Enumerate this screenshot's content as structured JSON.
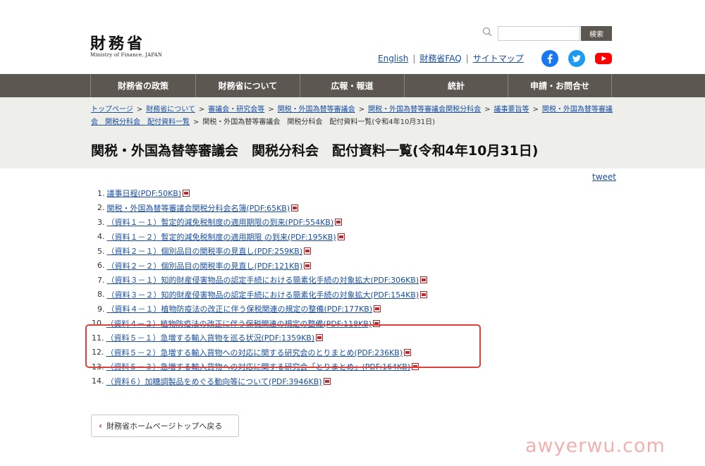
{
  "header": {
    "logo_main": "財務省",
    "logo_sub": "Ministry of Finance, JAPAN",
    "search_button": "検索",
    "links": [
      "English",
      "財務省FAQ",
      "サイトマップ"
    ],
    "social_icons": [
      "facebook-icon",
      "twitter-icon",
      "youtube-icon"
    ],
    "colors": {
      "facebook": "#1877f2",
      "twitter": "#1d9bf0",
      "youtube": "#ff0000"
    }
  },
  "nav": [
    "財務省の政策",
    "財務省について",
    "広報・報道",
    "統計",
    "申請・お問合せ"
  ],
  "breadcrumb": {
    "links": [
      "トップページ",
      "財務省について",
      "審議会・研究会等",
      "関税・外国為替等審議会",
      "関税・外国為替等審議会関税分科会",
      "議事要旨等",
      "関税・外国為替等審議会　関税分科会　配付資料一覧"
    ],
    "current": "関税・外国為替等審議会　関税分科会　配付資料一覧(令和4年10月31日)"
  },
  "page_title": "関税・外国為替等審議会　関税分科会　配付資料一覧(令和4年10月31日)",
  "tweet": "tweet",
  "documents": [
    {
      "num": "1.",
      "title": "議事日程(PDF:50KB)"
    },
    {
      "num": "2.",
      "title": "関税・外国為替等審議会関税分科会名簿(PDF:65KB)"
    },
    {
      "num": "3.",
      "title": "（資料１－１）暫定的減免税制度の適用期限の到来(PDF:554KB)"
    },
    {
      "num": "4.",
      "title": "（資料１－２）暫定的減免税制度の適用期限 の到来(PDF:195KB)"
    },
    {
      "num": "5.",
      "title": "（資料２－１）個別品目の関税率の見直し(PDF:259KB)"
    },
    {
      "num": "6.",
      "title": "（資料２－２）個別品目の関税率の見直し(PDF:121KB)"
    },
    {
      "num": "7.",
      "title": "（資料３－１）知的財産侵害物品の認定手続における簡素化手続の対象拡大(PDF:306KB)"
    },
    {
      "num": "8.",
      "title": "（資料３－２）知的財産侵害物品の認定手続における簡素化手続の対象拡大(PDF:154KB)"
    },
    {
      "num": "9.",
      "title": "（資料４－１）植物防疫法の改正に伴う保税関連の規定の整備(PDF:177KB)"
    },
    {
      "num": "10.",
      "title": "（資料４－２）植物防疫法の改正に伴う保税関連の規定の整備(PDF:118KB)"
    },
    {
      "num": "11.",
      "title": "（資料５－１）急増する輸入貨物を巡る状況(PDF:1359KB)"
    },
    {
      "num": "12.",
      "title": "（資料５－２）急増する輸入貨物への対応に関する研究会のとりまとめ(PDF:236KB)"
    },
    {
      "num": "13.",
      "title": "（資料５－３）急増する輸入貨物への対応に関する研究会「とりまとめ」(PDF:164KB)"
    },
    {
      "num": "14.",
      "title": "（資料６）加糖調製品をめぐる動向等について(PDF:3946KB)"
    }
  ],
  "back_button": "財務省ホームページトップへ戻る",
  "watermark": "awyerwu.com",
  "accent_colors": {
    "nav_bg": "#5c5751",
    "band_bg": "#eeeeeb",
    "link": "#1a4fa0",
    "highlight": "#d9413a"
  }
}
